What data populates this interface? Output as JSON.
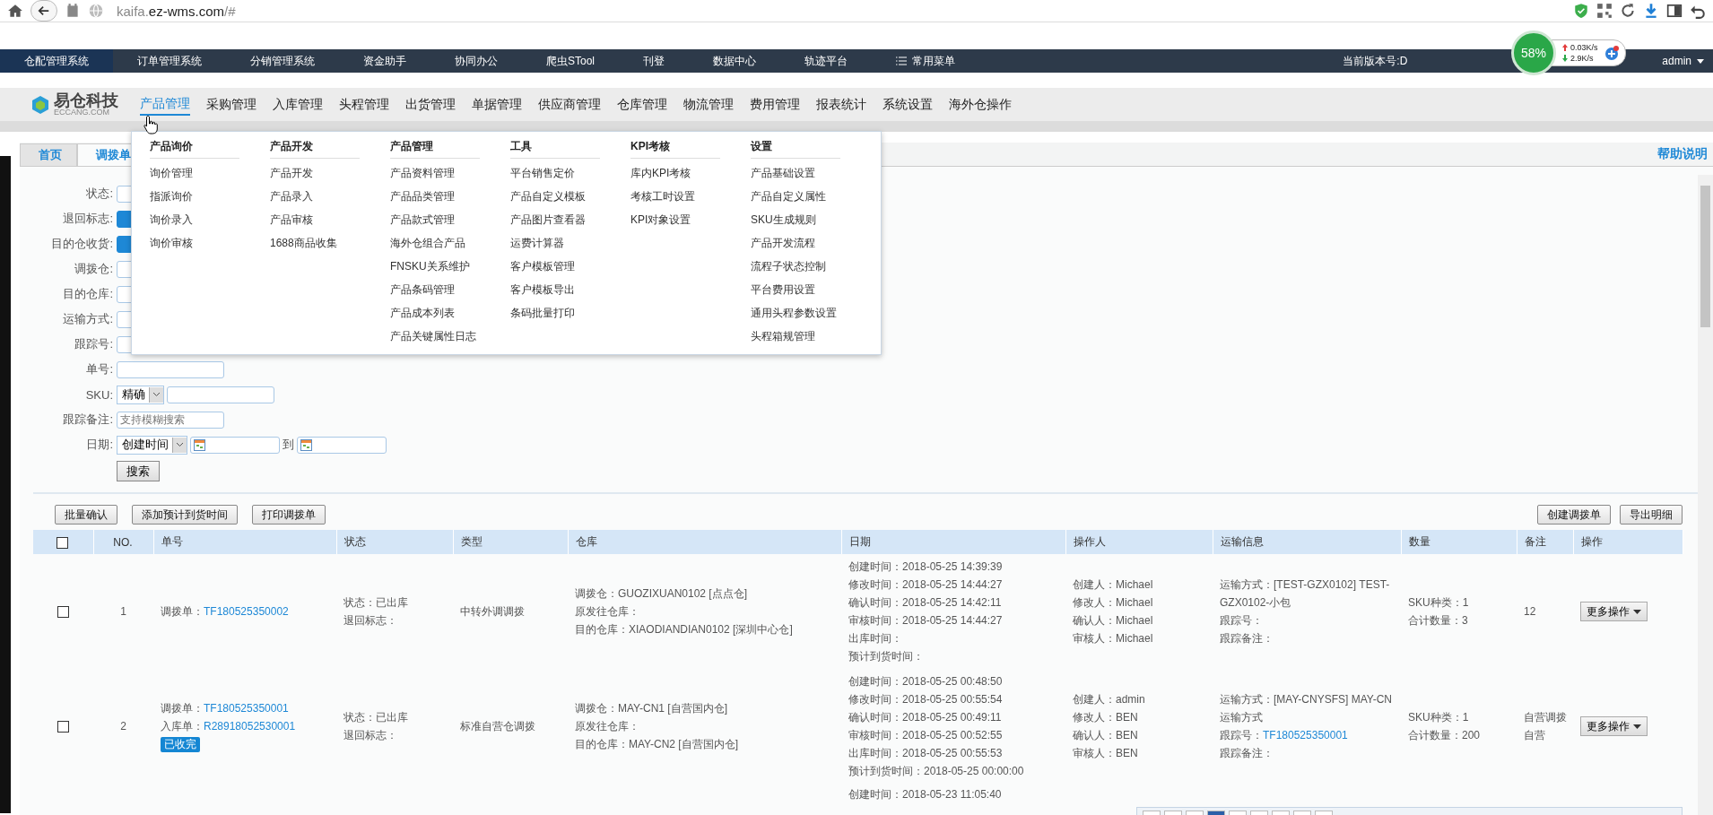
{
  "browser": {
    "url_host": "kaifa.",
    "url_domain": "ez-wms.com",
    "url_path": "/#"
  },
  "top_nav": {
    "items": [
      {
        "label": "仓配管理系统",
        "selected": true,
        "kind": "link"
      },
      {
        "label": "订单管理系统",
        "selected": false,
        "kind": "link"
      },
      {
        "label": "分销管理系统",
        "selected": false,
        "kind": "link"
      },
      {
        "label": "资金助手",
        "selected": false,
        "kind": "link"
      },
      {
        "label": "协同办公",
        "selected": false,
        "kind": "link"
      },
      {
        "label": "爬虫STool",
        "selected": false,
        "kind": "link"
      },
      {
        "label": "刊登",
        "selected": false,
        "kind": "link"
      },
      {
        "label": "数据中心",
        "selected": false,
        "kind": "link"
      },
      {
        "label": "轨迹平台",
        "selected": false,
        "kind": "link"
      },
      {
        "label": "常用菜单",
        "selected": false,
        "kind": "menu"
      }
    ],
    "version": "当前版本号:D",
    "user": "admin"
  },
  "net_monitor": {
    "percent": "58%",
    "upload": "0.03K/s",
    "download": "2.9K/s"
  },
  "logo": {
    "name": "易仓科技",
    "domain": "ECCANG.COM"
  },
  "main_menu": [
    {
      "label": "产品管理",
      "selected": true
    },
    {
      "label": "采购管理",
      "selected": false
    },
    {
      "label": "入库管理",
      "selected": false
    },
    {
      "label": "头程管理",
      "selected": false
    },
    {
      "label": "出货管理",
      "selected": false
    },
    {
      "label": "单据管理",
      "selected": false
    },
    {
      "label": "供应商管理",
      "selected": false
    },
    {
      "label": "仓库管理",
      "selected": false
    },
    {
      "label": "物流管理",
      "selected": false
    },
    {
      "label": "费用管理",
      "selected": false
    },
    {
      "label": "报表统计",
      "selected": false
    },
    {
      "label": "系统设置",
      "selected": false
    },
    {
      "label": "海外仓操作",
      "selected": false
    }
  ],
  "mega_menu": [
    {
      "heading": "产品询价",
      "items": [
        "询价管理",
        "指派询价",
        "询价录入",
        "询价审核"
      ]
    },
    {
      "heading": "产品开发",
      "items": [
        "产品开发",
        "产品录入",
        "产品审核",
        "1688商品收集"
      ]
    },
    {
      "heading": "产品管理",
      "items": [
        "产品资料管理",
        "产品品类管理",
        "产品款式管理",
        "海外仓组合产品",
        "FNSKU关系维护",
        "产品条码管理",
        "产品成本列表",
        "产品关键属性日志"
      ]
    },
    {
      "heading": "工具",
      "items": [
        "平台销售定价",
        "产品自定义模板",
        "产品图片查看器",
        "运费计算器",
        "客户模板管理",
        "客户模板导出",
        "条码批量打印"
      ]
    },
    {
      "heading": "KPI考核",
      "items": [
        "库内KPI考核",
        "考核工时设置",
        "KPI对象设置"
      ]
    },
    {
      "heading": "设置",
      "items": [
        "产品基础设置",
        "产品自定义属性",
        "SKU生成规则",
        "产品开发流程",
        "流程子状态控制",
        "平台费用设置",
        "通用头程参数设置",
        "头程箱规管理"
      ]
    }
  ],
  "tabs": [
    {
      "label": "首页",
      "selected": false
    },
    {
      "label": "调拨单",
      "selected": true
    }
  ],
  "help_link": "帮助说明",
  "filters": [
    {
      "label": "状态:",
      "kind": "blank"
    },
    {
      "label": "退回标志:",
      "kind": "choice"
    },
    {
      "label": "目的仓收货:",
      "kind": "choice"
    },
    {
      "label": "调拨仓:",
      "kind": "blank"
    },
    {
      "label": "目的仓库:",
      "kind": "blank"
    },
    {
      "label": "运输方式:",
      "kind": "blank"
    },
    {
      "label": "跟踪号:",
      "kind": "blank"
    },
    {
      "label": "单号:",
      "kind": "text"
    },
    {
      "label": "SKU:",
      "kind": "select_text",
      "select": "精确"
    },
    {
      "label": "跟踪备注:",
      "kind": "text",
      "placeholder": "支持模糊搜索"
    },
    {
      "label": "日期:",
      "kind": "date_range",
      "select": "创建时间",
      "separator": "到"
    }
  ],
  "search_button": "搜索",
  "toolbar": {
    "left_buttons": [
      "批量确认",
      "添加预计到货时间",
      "打印调拨单"
    ],
    "right_buttons": [
      "创建调拨单",
      "导出明细"
    ]
  },
  "table": {
    "select_all_checked": false,
    "columns": [
      "NO.",
      "单号",
      "状态",
      "类型",
      "仓库",
      "日期",
      "操作人",
      "运输信息",
      "数量",
      "备注",
      "操作"
    ],
    "rows": [
      {
        "checked": false,
        "no": "1",
        "order_lines": [
          {
            "label": "调拨单：",
            "value": "TF180525350002"
          }
        ],
        "status_lines": [
          "状态：已出库",
          "退回标志："
        ],
        "type": "中转外调调拨",
        "warehouse_lines": [
          "调拨仓：GUOZIXUAN0102 [点点仓]",
          "原发往仓库：",
          "目的仓库：XIAODIANDIAN0102 [深圳中心仓]"
        ],
        "date_lines": [
          "创建时间：2018-05-25 14:39:39",
          "修改时间：2018-05-25 14:44:27",
          "确认时间：2018-05-25 14:42:11",
          "审核时间：2018-05-25 14:44:27",
          "出库时间：",
          "预计到货时间："
        ],
        "operator_lines": [
          "创建人：Michael",
          "修改人：Michael",
          "确认人：Michael",
          "审核人：Michael"
        ],
        "shipping_lines": [
          {
            "label": "运输方式：[TEST-GZX0102] TEST-GZX0102-小包"
          },
          {
            "label": "跟踪号："
          },
          {
            "label": "跟踪备注："
          }
        ],
        "qty_lines": [
          "SKU种类：1",
          "合计数量：3"
        ],
        "remark_lines": [
          "12"
        ],
        "action": "更多操作"
      },
      {
        "checked": false,
        "no": "2",
        "order_lines": [
          {
            "label": "调拨单：",
            "value": "TF180525350001"
          },
          {
            "label": "入库单：",
            "value": "R28918052530001"
          }
        ],
        "badge": "已收完",
        "status_lines": [
          "状态：已出库",
          "退回标志："
        ],
        "type": "标准自营仓调拨",
        "warehouse_lines": [
          "调拨仓：MAY-CN1 [自营国内仓]",
          "原发往仓库：",
          "目的仓库：MAY-CN2 [自营国内仓]"
        ],
        "date_lines": [
          "创建时间：2018-05-25 00:48:50",
          "修改时间：2018-05-25 00:55:54",
          "确认时间：2018-05-25 00:49:11",
          "审核时间：2018-05-25 00:52:55",
          "出库时间：2018-05-25 00:55:53",
          "预计到货时间：2018-05-25 00:00:00"
        ],
        "operator_lines": [
          "创建人：admin",
          "修改人：BEN",
          "确认人：BEN",
          "审核人：BEN"
        ],
        "shipping_lines": [
          {
            "label": "运输方式：[MAY-CNYSFS] MAY-CN运输方式"
          },
          {
            "label": "跟踪号：",
            "value": "TF180525350001"
          },
          {
            "label": "跟踪备注："
          }
        ],
        "qty_lines": [
          "SKU种类：1",
          "合计数量：200"
        ],
        "remark_lines": [
          "自营调拨",
          "自营"
        ],
        "action": "更多操作"
      },
      {
        "date_lines": [
          "创建时间：2018-05-23 11:05:40"
        ]
      }
    ]
  }
}
